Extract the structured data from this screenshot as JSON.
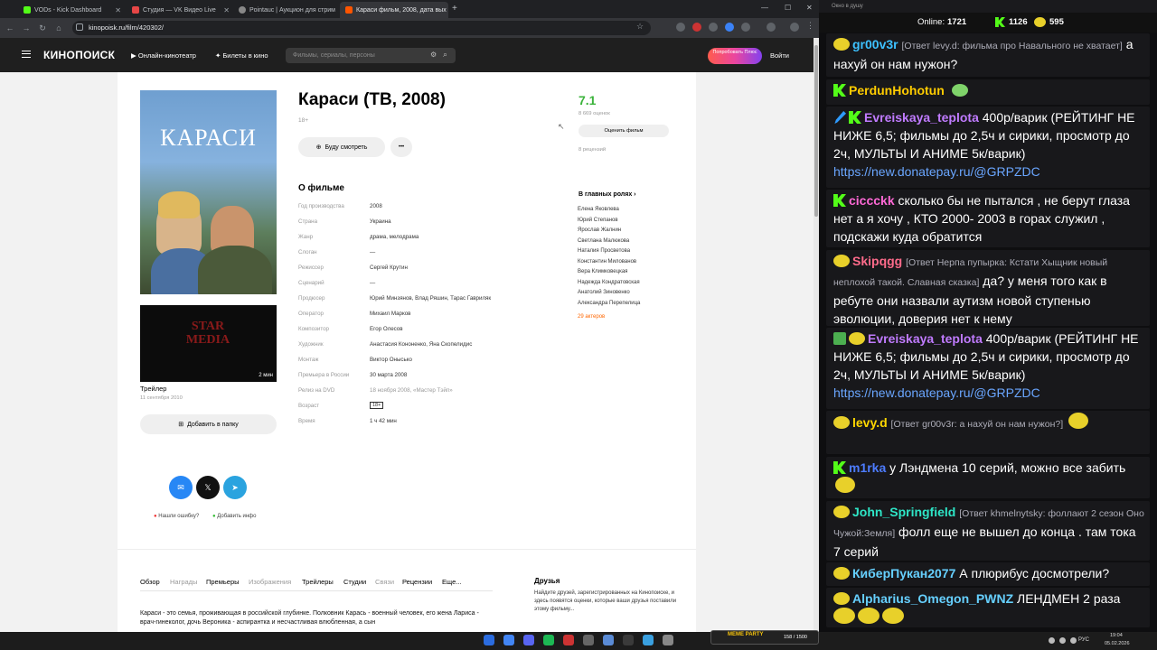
{
  "browser": {
    "tabs": [
      {
        "label": "VODs - Kick Dashboard",
        "color": "#53fc18"
      },
      {
        "label": "Студия — VK Видео Live",
        "color": "#e64646"
      },
      {
        "label": "Pointauc | Аукцион для стрим",
        "color": "#444"
      },
      {
        "label": "Караси фильм, 2008, дата вых",
        "color": "#f50"
      }
    ],
    "url": "kinopoisk.ru/film/420302/"
  },
  "site": {
    "logo": "КИНОПОИСК",
    "nav": [
      "Онлайн-кинотеатр",
      "Билеты в кино"
    ],
    "search_placeholder": "Фильмы, сериалы, персоны",
    "plus_button": "Попробовать Плюс",
    "login": "Войти"
  },
  "film": {
    "title": "Караси (ТВ, 2008)",
    "age": "18+",
    "poster_text": "КАРАСИ",
    "watch_later": "Буду смотреть",
    "more": "•••",
    "trailer_label": "Трейлер",
    "trailer_date": "11 сентября 2010",
    "trailer_duration": "2 мин",
    "trailer_logo_top": "STAR",
    "trailer_logo_bottom": "MEDIA",
    "add_folder": "Добавить в папку",
    "about_heading": "О фильме",
    "details": [
      {
        "k": "Год производства",
        "v": "2008"
      },
      {
        "k": "Страна",
        "v": "Украина"
      },
      {
        "k": "Жанр",
        "v": "драма, мелодрама"
      },
      {
        "k": "Слоган",
        "v": "—"
      },
      {
        "k": "Режиссер",
        "v": "Сергей Крутин"
      },
      {
        "k": "Сценарий",
        "v": "—"
      },
      {
        "k": "Продюсер",
        "v": "Юрий Минзянов, Влад Ряшин, Тарас Гавриляк"
      },
      {
        "k": "Оператор",
        "v": "Михаил Марков"
      },
      {
        "k": "Композитор",
        "v": "Егор Олесов"
      },
      {
        "k": "Художник",
        "v": "Анастасия Кононенко, Яна Скопелидис"
      },
      {
        "k": "Монтаж",
        "v": "Виктор Онысько"
      },
      {
        "k": "Премьера в России",
        "v": "30 марта 2008"
      },
      {
        "k": "Релиз на DVD",
        "v": "18 ноября 2008, «Мастер Тэйп»"
      },
      {
        "k": "Возраст",
        "v": "18+"
      },
      {
        "k": "Время",
        "v": "1 ч 42 мин"
      }
    ],
    "rating": "7.1",
    "rating_count": "8 669 оценок",
    "rate_button": "Оценить фильм",
    "reviews": "8 рецензий",
    "cast_heading": "В главных ролях ›",
    "cast": [
      "Елена Яковлева",
      "Юрий Степанов",
      "Ярослав Жалнин",
      "Светлана Малюкова",
      "Наталия Просветова",
      "Константин Милованов",
      "Вера Климковецкая",
      "Надежда Кондратовская",
      "Анатолий Зиновенко",
      "Александра Перепелица"
    ],
    "cast_more": "29 актеров",
    "report_error": "Нашли ошибку?",
    "add_info": "Добавить инфо",
    "bottom_nav": [
      "Обзор",
      "Награды",
      "Премьеры",
      "Изображения",
      "Трейлеры",
      "Студии",
      "Связи",
      "Рецензии",
      "Еще..."
    ],
    "synopsis": "Караси - это семья, проживающая в российской глубинке. Полковник Карась - военный человек, его жена Лариса - врач-гинеколог, дочь Вероника - аспирантка и несчастливая влюбленная, а сын",
    "friends_heading": "Друзья",
    "friends_text": "Найдите друзей, зарегистрированных на Кинопоиске, и здесь появятся оценки, которые ваши друзья поставили этому фильму..."
  },
  "chat": {
    "window_title": "Окно в душу",
    "online_label": "Online:",
    "online": "1721",
    "kick_count": "1126",
    "other_count": "595",
    "messages": [
      {
        "user": "gr00v3r",
        "color": "#3dc1ff",
        "reply": "[Ответ levy.d: фильма про Навального не хватает]",
        "text": "а нахуй он нам нужон?"
      },
      {
        "user": "PerdunHohotun",
        "color": "#ffcc00",
        "reply": "",
        "text": ""
      },
      {
        "user": "Evreiskaya_teplota",
        "color": "#c07bff",
        "reply": "",
        "text": "400р/варик (РЕЙТИНГ НЕ НИЖЕ 6,5; фильмы до 2,5ч и сирики, просмотр до 2ч, МУЛЬТЫ И АНИМЕ 5к/варик)",
        "link": "https://new.donatepay.ru/@GRPZDC"
      },
      {
        "user": "ciccckk",
        "color": "#ff69d6",
        "reply": "",
        "text": "сколько бы не пытался , не берут глаза нет а я хочу , КТО 2000- 2003 в горах служил , подскажи куда обратится"
      },
      {
        "user": "Skipqgg",
        "color": "#ff6b8b",
        "reply": "[Ответ Нерпа пупырка: Кстати Хыщник новый неплохой такой. Славная сказка]",
        "text": "да? у меня того как в ребуте они назвали аутизм новой ступенью эволюции, доверия нет к нему"
      },
      {
        "user": "Evreiskaya_teplota",
        "color": "#c07bff",
        "reply": "",
        "text": "400р/варик (РЕЙТИНГ НЕ НИЖЕ 6,5; фильмы до 2,5ч и сирики, просмотр до 2ч, МУЛЬТЫ И АНИМЕ 5к/варик)",
        "link": "https://new.donatepay.ru/@GRPZDC"
      },
      {
        "user": "levy.d",
        "color": "#ffd700",
        "reply": "[Ответ gr00v3r: а нахуй он нам нужон?]",
        "text": ""
      },
      {
        "user": "m1rka",
        "color": "#4d7cff",
        "reply": "",
        "text": "у Лэндмена 10 серий, можно все забить"
      },
      {
        "user": "John_Springfield",
        "color": "#2ee6c7",
        "reply": "[Ответ khmelnytsky: фоллают 2 сезон  Оно Чужой:Земля]",
        "text": "фолл еще не вышел до конца . там тока 7 серий"
      },
      {
        "user": "КиберПукан2077",
        "color": "#66d0ff",
        "reply": "",
        "text": "А плюрибус досмотрели?"
      },
      {
        "user": "Alpharius_Omegon_PWNZ",
        "color": "#66d0ff",
        "reply": "",
        "text": "ЛЕНДМЕН 2 раза"
      }
    ]
  },
  "taskbar": {
    "meme_party": "MEME PARTY",
    "meme_count": "158 / 1500",
    "lang": "РУС",
    "time": "19:04",
    "date": "05.02.2026"
  }
}
